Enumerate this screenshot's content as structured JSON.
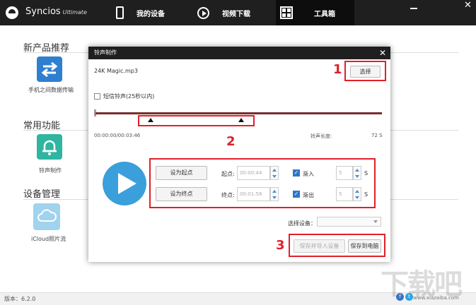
{
  "app": {
    "brand": "Syncios",
    "brand_sub": "Ultimate"
  },
  "nav": {
    "tabs": [
      {
        "label": "我的设备",
        "icon": "phone-icon"
      },
      {
        "label": "视频下载",
        "icon": "play-icon"
      },
      {
        "label": "工具箱",
        "icon": "toolbox-icon",
        "active": true
      }
    ]
  },
  "sections": {
    "new_products": {
      "title": "新产品推荐",
      "items": [
        {
          "label": "手机之间数据传输",
          "icon": "transfer-arrows-icon",
          "color": "#2f7fd0"
        }
      ]
    },
    "common": {
      "title": "常用功能",
      "items": [
        {
          "label": "铃声制作",
          "icon": "bell-icon",
          "color": "#2fb5a0"
        }
      ]
    },
    "device_mgmt": {
      "title": "设备管理",
      "items": [
        {
          "label": "iCloud照片流",
          "icon": "cloud-icon",
          "color": "#9fd3ee"
        }
      ]
    }
  },
  "status": {
    "version": "版本：6.2.0"
  },
  "dialog": {
    "title": "铃声制作",
    "file_name": "24K Magic.mp3",
    "select_label": "选择",
    "short_ringtone_label": "短信铃声(25秒以内)",
    "short_ringtone_checked": false,
    "time_display": "00:00:00/00:03:46",
    "length_label": "铃声长度:",
    "length_value": "72 S",
    "start": {
      "button": "设为起点",
      "label": "起点:",
      "value": "00:00:44",
      "fade_label": "渐入",
      "fade_checked": true,
      "fade_value": "5",
      "unit": "S"
    },
    "end": {
      "button": "设为终点",
      "label": "终点:",
      "value": "00:01:56",
      "fade_label": "渐出",
      "fade_checked": true,
      "fade_value": "5",
      "unit": "S"
    },
    "device_label": "选择设备：",
    "device_value": "",
    "import_label": "保存并导入设备",
    "save_label": "保存到电脑"
  },
  "annotations": {
    "marks": [
      "1",
      "2",
      "3"
    ],
    "color": "#e0202a"
  },
  "watermark": {
    "text": "下载吧",
    "url": "www.xiazaiba.com"
  }
}
